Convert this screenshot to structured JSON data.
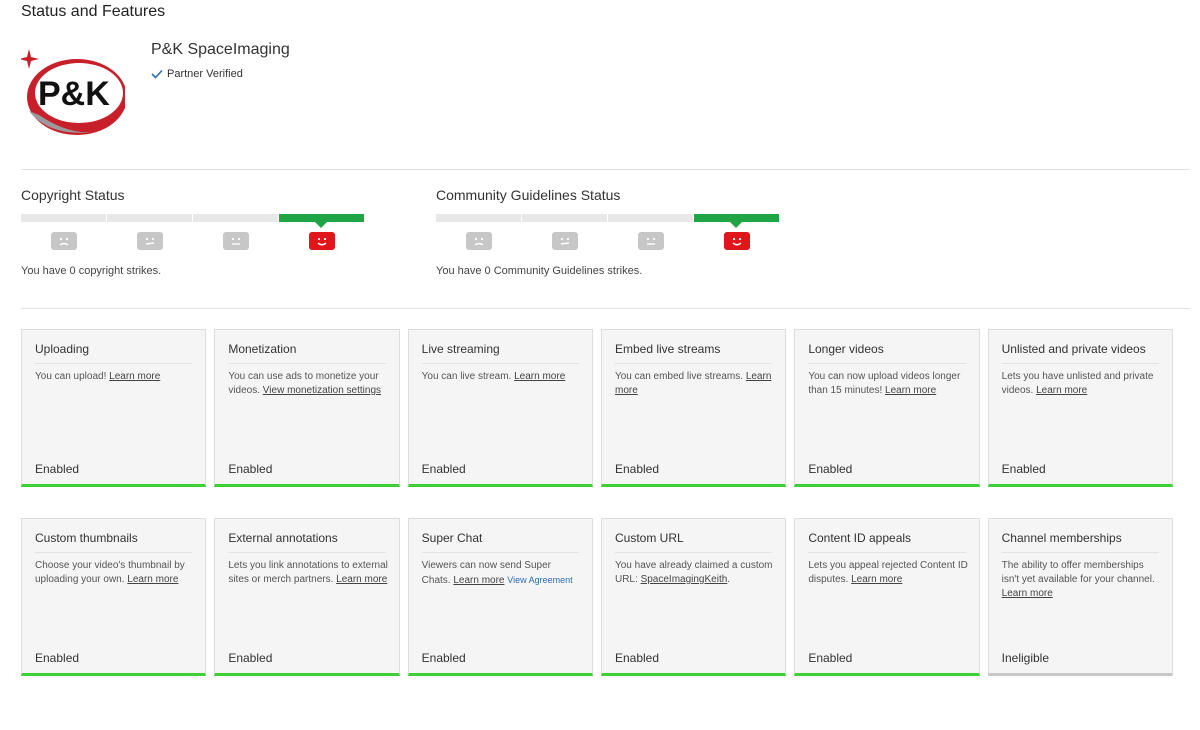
{
  "page": {
    "title": "Status and Features"
  },
  "channel": {
    "name": "P&K SpaceImaging",
    "verified_label": "Partner Verified",
    "logo_text": "P&K"
  },
  "copyright": {
    "title": "Copyright Status",
    "note": "You have 0 copyright strikes.",
    "active_index": 3
  },
  "community": {
    "title": "Community Guidelines Status",
    "note": "You have 0 Community Guidelines strikes.",
    "active_index": 3
  },
  "colors": {
    "active_green": "#1fa446",
    "active_red": "#e0161b",
    "enabled_bar": "#3fcf36",
    "inactive_gray": "#c7c7c7"
  },
  "features_row1": [
    {
      "title": "Uploading",
      "text": "You can upload!",
      "link": "Learn more",
      "state": "Enabled"
    },
    {
      "title": "Monetization",
      "text": "You can use ads to monetize your videos.",
      "link": "View monetization settings",
      "state": "Enabled"
    },
    {
      "title": "Live streaming",
      "text": "You can live stream.",
      "link": "Learn more",
      "state": "Enabled"
    },
    {
      "title": "Embed live streams",
      "text": "You can embed live streams.",
      "link": "Learn more",
      "state": "Enabled"
    },
    {
      "title": "Longer videos",
      "text": "You can now upload videos longer than 15 minutes!",
      "link": "Learn more",
      "state": "Enabled"
    },
    {
      "title": "Unlisted and private videos",
      "text": "Lets you have unlisted and private videos.",
      "link": "Learn more",
      "state": "Enabled"
    }
  ],
  "features_row2": [
    {
      "title": "Custom thumbnails",
      "text": "Choose your video's thumbnail by uploading your own.",
      "link": "Learn more",
      "state": "Enabled"
    },
    {
      "title": "External annotations",
      "text": "Lets you link annotations to external sites or merch partners.",
      "link": "Learn more",
      "state": "Enabled"
    },
    {
      "title": "Super Chat",
      "text": "Viewers can now send Super Chats.",
      "link": "Learn more",
      "extra": "View Agreement",
      "state": "Enabled"
    },
    {
      "title": "Custom URL",
      "text": "You have already claimed a custom URL:",
      "link": "SpaceImagingKeith",
      "after": ".",
      "state": "Enabled"
    },
    {
      "title": "Content ID appeals",
      "text": "Lets you appeal rejected Content ID disputes.",
      "link": "Learn more",
      "state": "Enabled"
    },
    {
      "title": "Channel memberships",
      "text": "The ability to offer memberships isn't yet available for your channel.",
      "link": "Learn more",
      "state": "Ineligible"
    }
  ]
}
